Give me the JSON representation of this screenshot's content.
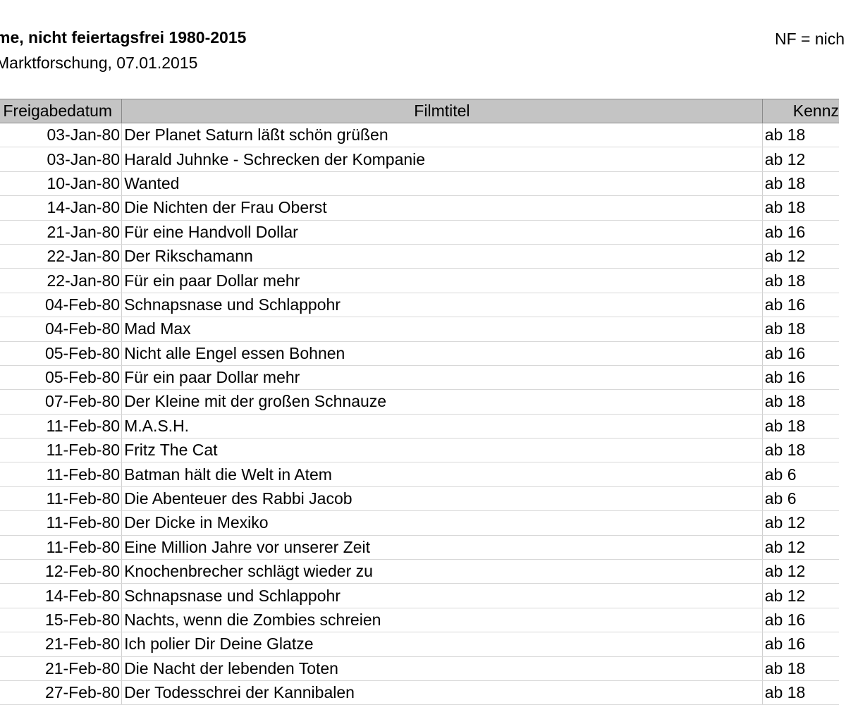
{
  "header": {
    "title": "me, nicht feiertagsfrei 1980-2015",
    "subtitle": "Marktforschung, 07.01.2015",
    "note": "NF = nich"
  },
  "table": {
    "columns": [
      "Freigabedatum",
      "Filmtitel",
      "Kennz"
    ],
    "rows": [
      {
        "date": "03-Jan-80",
        "title": "Der Planet Saturn läßt schön grüßen",
        "rating": "ab 18"
      },
      {
        "date": "03-Jan-80",
        "title": "Harald Juhnke - Schrecken der Kompanie",
        "rating": "ab 12"
      },
      {
        "date": "10-Jan-80",
        "title": "Wanted",
        "rating": "ab 18"
      },
      {
        "date": "14-Jan-80",
        "title": "Die Nichten der Frau Oberst",
        "rating": "ab 18"
      },
      {
        "date": "21-Jan-80",
        "title": "Für eine Handvoll Dollar",
        "rating": "ab 16"
      },
      {
        "date": "22-Jan-80",
        "title": "Der Rikschamann",
        "rating": "ab 12"
      },
      {
        "date": "22-Jan-80",
        "title": "Für ein paar Dollar mehr",
        "rating": "ab 18"
      },
      {
        "date": "04-Feb-80",
        "title": "Schnapsnase und Schlappohr",
        "rating": "ab 16"
      },
      {
        "date": "04-Feb-80",
        "title": "Mad Max",
        "rating": "ab 18"
      },
      {
        "date": "05-Feb-80",
        "title": "Nicht alle Engel essen Bohnen",
        "rating": "ab 16"
      },
      {
        "date": "05-Feb-80",
        "title": "Für ein paar Dollar mehr",
        "rating": "ab 16"
      },
      {
        "date": "07-Feb-80",
        "title": "Der Kleine mit der großen Schnauze",
        "rating": "ab 18"
      },
      {
        "date": "11-Feb-80",
        "title": "M.A.S.H.",
        "rating": "ab 18"
      },
      {
        "date": "11-Feb-80",
        "title": "Fritz The Cat",
        "rating": "ab 18"
      },
      {
        "date": "11-Feb-80",
        "title": "Batman hält die Welt in Atem",
        "rating": "ab 6"
      },
      {
        "date": "11-Feb-80",
        "title": "Die Abenteuer des Rabbi Jacob",
        "rating": "ab 6"
      },
      {
        "date": "11-Feb-80",
        "title": "Der Dicke in Mexiko",
        "rating": "ab 12"
      },
      {
        "date": "11-Feb-80",
        "title": "Eine Million Jahre vor unserer Zeit",
        "rating": "ab 12"
      },
      {
        "date": "12-Feb-80",
        "title": "Knochenbrecher schlägt wieder zu",
        "rating": "ab 12"
      },
      {
        "date": "14-Feb-80",
        "title": "Schnapsnase und Schlappohr",
        "rating": "ab 12"
      },
      {
        "date": "15-Feb-80",
        "title": "Nachts, wenn die Zombies schreien",
        "rating": "ab 16"
      },
      {
        "date": "21-Feb-80",
        "title": "Ich polier Dir Deine Glatze",
        "rating": "ab 16"
      },
      {
        "date": "21-Feb-80",
        "title": "Die Nacht der lebenden Toten",
        "rating": "ab 18"
      },
      {
        "date": "27-Feb-80",
        "title": "Der Todesschrei der Kannibalen",
        "rating": "ab 18"
      }
    ]
  }
}
